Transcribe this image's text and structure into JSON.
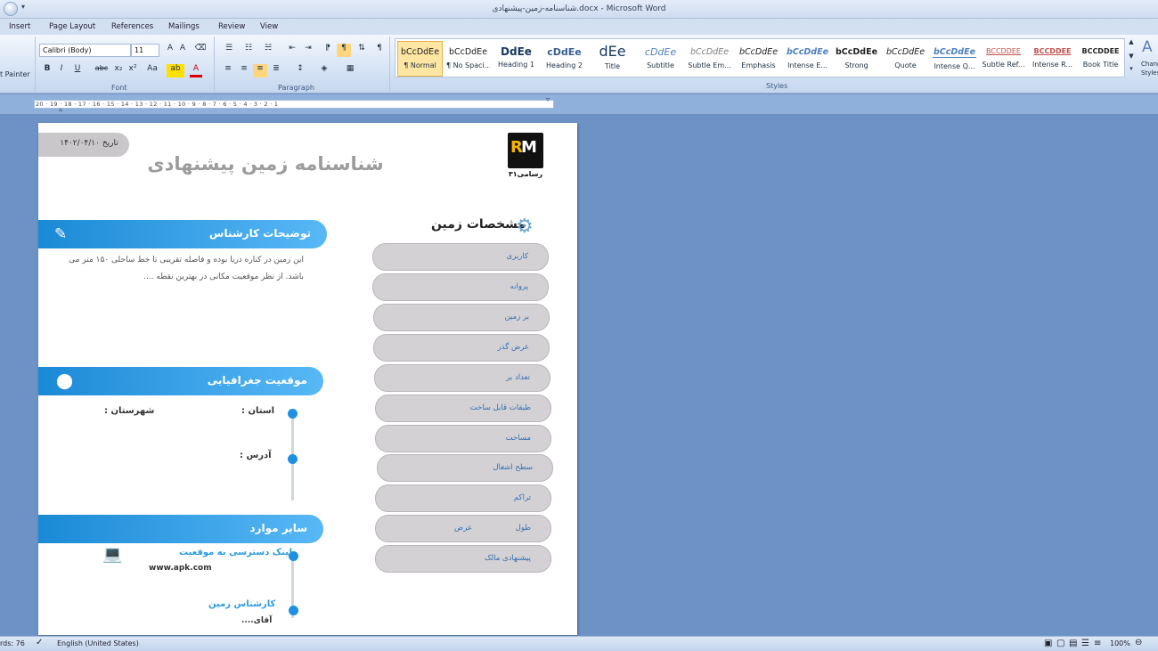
{
  "window": {
    "title": "شناسنامه-زمین-پیشنهادی.docx - Microsoft Word"
  },
  "menu": [
    "Insert",
    "Page Layout",
    "References",
    "Mailings",
    "Review",
    "View"
  ],
  "ribbon": {
    "painter_label": "t Painter",
    "font": {
      "name": "Calibri (Body)",
      "size": "11",
      "group_label": "Font"
    },
    "paragraph_label": "Paragraph",
    "styles_label": "Styles",
    "styles": [
      {
        "preview": "bCcDdEe",
        "label": "¶ Normal"
      },
      {
        "preview": "bCcDdEe",
        "label": "¶ No Spaci..."
      },
      {
        "preview": "DdEe",
        "label": "Heading 1"
      },
      {
        "preview": "cDdEe",
        "label": "Heading 2"
      },
      {
        "preview": "dEe",
        "label": "Title"
      },
      {
        "preview": "cDdEe",
        "label": "Subtitle"
      },
      {
        "preview": "bCcDdEe",
        "label": "Subtle Em..."
      },
      {
        "preview": "bCcDdEe",
        "label": "Emphasis"
      },
      {
        "preview": "bCcDdEe",
        "label": "Intense E..."
      },
      {
        "preview": "bCcDdEe",
        "label": "Strong"
      },
      {
        "preview": "bCcDdEe",
        "label": "Quote"
      },
      {
        "preview": "bCcDdEe",
        "label": "Intense Q..."
      },
      {
        "preview": "BCCDDEE",
        "label": "Subtle Ref..."
      },
      {
        "preview": "BCCDDEE",
        "label": "Intense R..."
      },
      {
        "preview": "BCCDDEE",
        "label": "Book Title"
      }
    ],
    "change_styles": "Change Styles"
  },
  "ruler": {
    "numbers": "20 · 19 · 18 · 17 · 16 · 15 · 14 · 13 · 12 · 11 · 10 · 9 · 8 · 7 · 6 · 5 · 4 · 3 · 2 · 1"
  },
  "doc": {
    "date": "تاریخ ۱۴۰۲/۰۴/۱۰",
    "title": "شناسنامه زمین پیشنهادی",
    "logo_text": "رسامی۳۱",
    "expert_header": "توضیحات کارشناس",
    "expert_text": "این زمین در کناره دریا بوده و فاصله تقریبی تا خط ساحلی ۱۵۰ متر می باشد. از نظر موقعیت مکانی در بهترین نقطه ....",
    "geo_header": "موقعیت جغرافیایی",
    "province": "استان :",
    "city": "شهرستان :",
    "address": "آدرس :",
    "other_header": "سایر موارد",
    "link_label": "لینک دسترسی به موقعیت",
    "link_value": "www.apk.com",
    "expert_label": "کارشناس زمین",
    "expert_value": "آقای....",
    "specs_header": "مشخصات زمین",
    "specs": [
      "کاربری",
      "پروانه",
      "بر زمین",
      "عرض گذر",
      "تعداد بر",
      "طبقات قابل ساخت",
      "مساحت",
      "سطح اشغال",
      "تراکم",
      "طول",
      "پیشنهادی مالک"
    ],
    "width_label": "عرض"
  },
  "status": {
    "words": "rds: 76",
    "language": "English (United States)",
    "zoom": "100%"
  }
}
